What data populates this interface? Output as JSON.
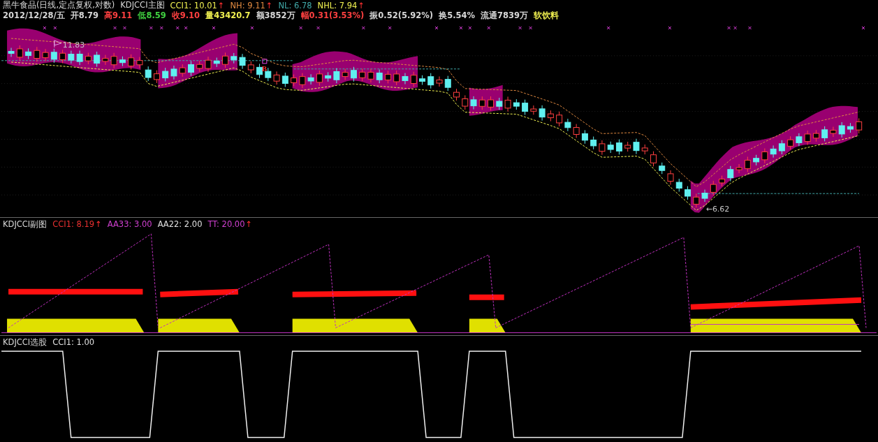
{
  "main": {
    "title": "黑牛食品(日线,定点复权,对数)",
    "indicator": "KDJCCI主图",
    "readings": [
      {
        "text": "CCI1: 10.01",
        "arrow": "↑",
        "color": "#f0f050"
      },
      {
        "text": "NH: 9.11",
        "arrow": "↑",
        "color": "#e08a40"
      },
      {
        "text": "NL: 6.78",
        "color": "#40a8a8"
      },
      {
        "text": "NHL: 7.94",
        "arrow": "↑",
        "color": "#f0f050"
      }
    ],
    "quote": [
      {
        "text": "2012/12/28/五",
        "color": "#d8d8d8"
      },
      {
        "text": "开8.79",
        "color": "#d8d8d8"
      },
      {
        "text": "高9.11",
        "color": "#ff4040"
      },
      {
        "text": "低8.59",
        "color": "#40d040"
      },
      {
        "text": "收9.10",
        "color": "#ff4040"
      },
      {
        "text": "量43420.7",
        "color": "#f0f050"
      },
      {
        "text": "额3852万",
        "color": "#d8d8d8"
      },
      {
        "text": "幅0.31(3.53%)",
        "color": "#ff4040"
      },
      {
        "text": "振0.52(5.92%)",
        "color": "#d8d8d8"
      },
      {
        "text": "换5.54%",
        "color": "#d8d8d8"
      },
      {
        "text": "流通7839万",
        "color": "#d8d8d8"
      },
      {
        "text": "软饮料",
        "color": "#f0f050"
      }
    ],
    "high_label": "11.83",
    "low_label": "←6.62",
    "buy_label": "B"
  },
  "sub": {
    "title": "KDJCCI副图",
    "readings": [
      {
        "text": "CCI1: 8.19",
        "arrow": "↑",
        "color": "#e83030"
      },
      {
        "text": "AA33: 3.00",
        "color": "#d040d0"
      },
      {
        "text": "AA22: 2.00",
        "color": "#e0e0e0"
      },
      {
        "text": "TT: 20.00",
        "arrow": "↑",
        "color": "#d040d0"
      }
    ]
  },
  "pick": {
    "title": "KDJCCI选股",
    "readings": [
      {
        "text": "CCI1: 1.00",
        "color": "#e0e0e0"
      }
    ]
  }
}
